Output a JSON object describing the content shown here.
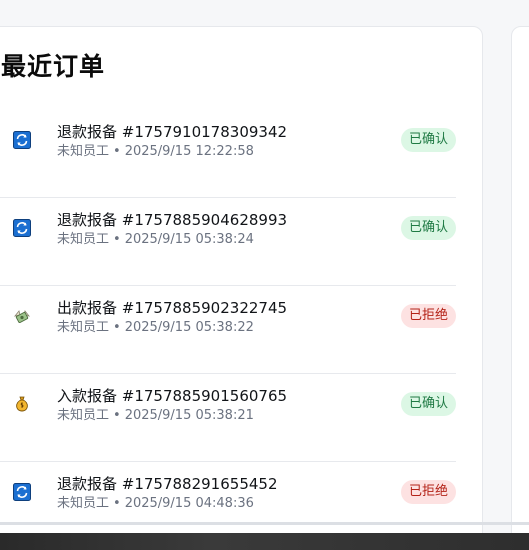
{
  "section": {
    "title": "最近订单"
  },
  "orders": [
    {
      "icon": "refund-arrows-icon",
      "title": "退款报备 #1757910178309342",
      "employee": "未知员工",
      "separator": "•",
      "time": "2025/9/15 12:22:58",
      "status": "已确认",
      "status_kind": "ok"
    },
    {
      "icon": "refund-arrows-icon",
      "title": "退款报备 #1757885904628993",
      "employee": "未知员工",
      "separator": "•",
      "time": "2025/9/15 05:38:24",
      "status": "已确认",
      "status_kind": "ok"
    },
    {
      "icon": "money-wings-icon",
      "title": "出款报备 #1757885902322745",
      "employee": "未知员工",
      "separator": "•",
      "time": "2025/9/15 05:38:22",
      "status": "已拒绝",
      "status_kind": "no"
    },
    {
      "icon": "money-bag-icon",
      "title": "入款报备 #1757885901560765",
      "employee": "未知员工",
      "separator": "•",
      "time": "2025/9/15 05:38:21",
      "status": "已确认",
      "status_kind": "ok"
    },
    {
      "icon": "refund-arrows-icon",
      "title": "退款报备 #175788291655452",
      "employee": "未知员工",
      "separator": "•",
      "time": "2025/9/15 04:48:36",
      "status": "已拒绝",
      "status_kind": "no"
    }
  ],
  "colors": {
    "confirmed_bg": "#dcf7e5",
    "confirmed_text": "#1f7a44",
    "rejected_bg": "#fde2e2",
    "rejected_text": "#b42318",
    "refund_icon_blue": "#1b6fd1"
  }
}
